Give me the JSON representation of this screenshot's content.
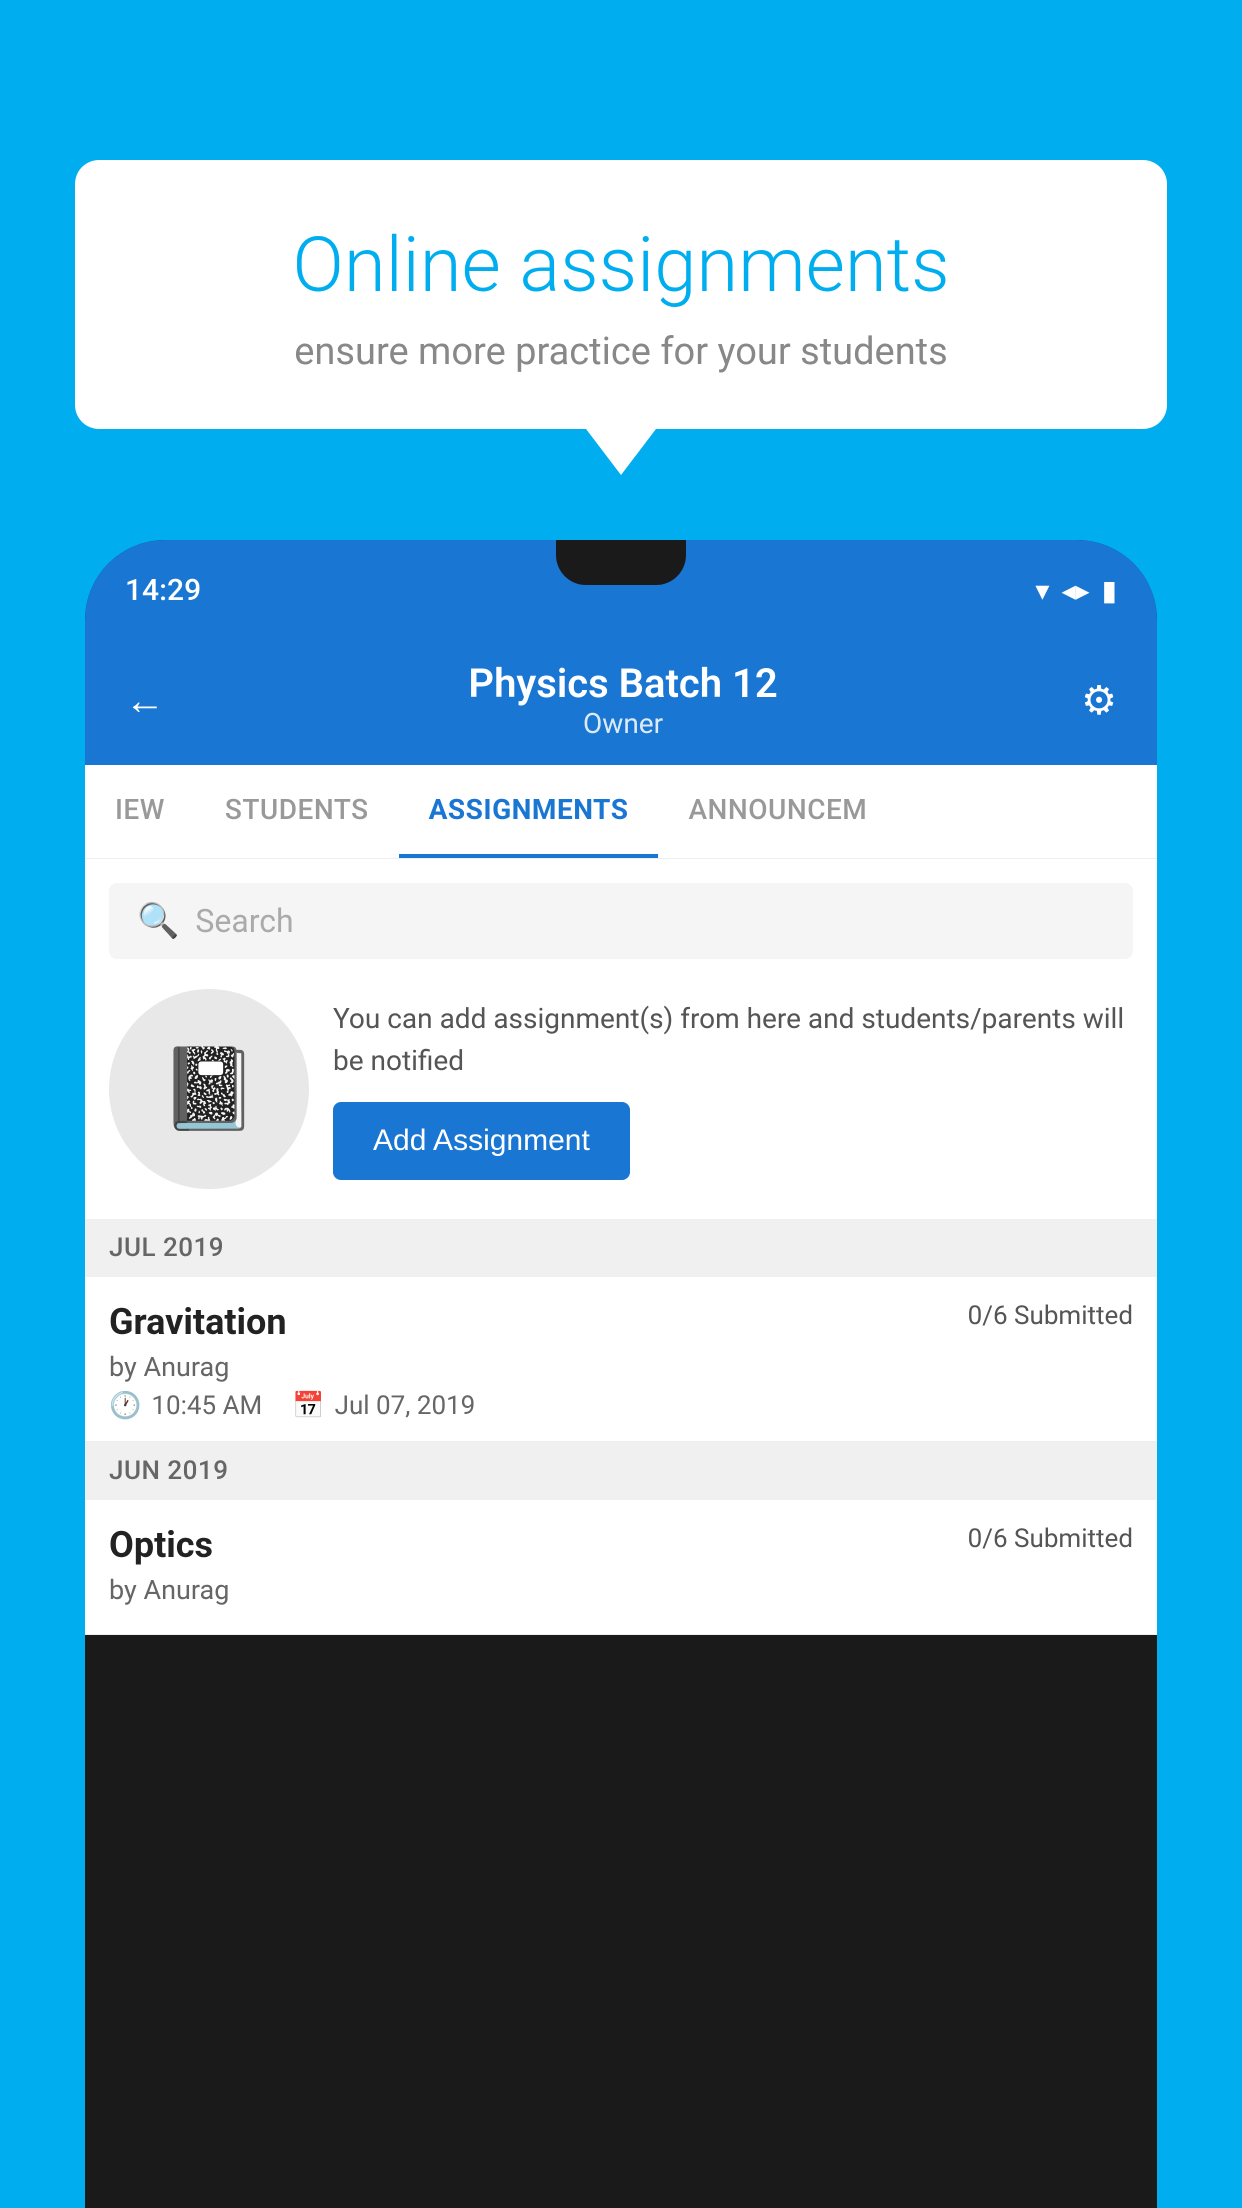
{
  "background": {
    "color": "#00AEEF"
  },
  "speech_bubble": {
    "title": "Online assignments",
    "subtitle": "ensure more practice for your students"
  },
  "phone": {
    "status_bar": {
      "time": "14:29",
      "wifi": "▾",
      "signal": "▲",
      "battery": "▮"
    },
    "header": {
      "back_label": "←",
      "title": "Physics Batch 12",
      "subtitle": "Owner",
      "settings_label": "⚙"
    },
    "tabs": [
      {
        "label": "IEW",
        "active": false
      },
      {
        "label": "STUDENTS",
        "active": false
      },
      {
        "label": "ASSIGNMENTS",
        "active": true
      },
      {
        "label": "ANNOUNCEM",
        "active": false
      }
    ],
    "search": {
      "placeholder": "Search"
    },
    "add_assignment": {
      "description": "You can add assignment(s) from here and students/parents will be notified",
      "button_label": "Add Assignment"
    },
    "sections": [
      {
        "title": "JUL 2019",
        "items": [
          {
            "name": "Gravitation",
            "submitted": "0/6 Submitted",
            "by": "by Anurag",
            "time": "10:45 AM",
            "date": "Jul 07, 2019"
          }
        ]
      },
      {
        "title": "JUN 2019",
        "items": [
          {
            "name": "Optics",
            "submitted": "0/6 Submitted",
            "by": "by Anurag",
            "time": "",
            "date": ""
          }
        ]
      }
    ]
  }
}
